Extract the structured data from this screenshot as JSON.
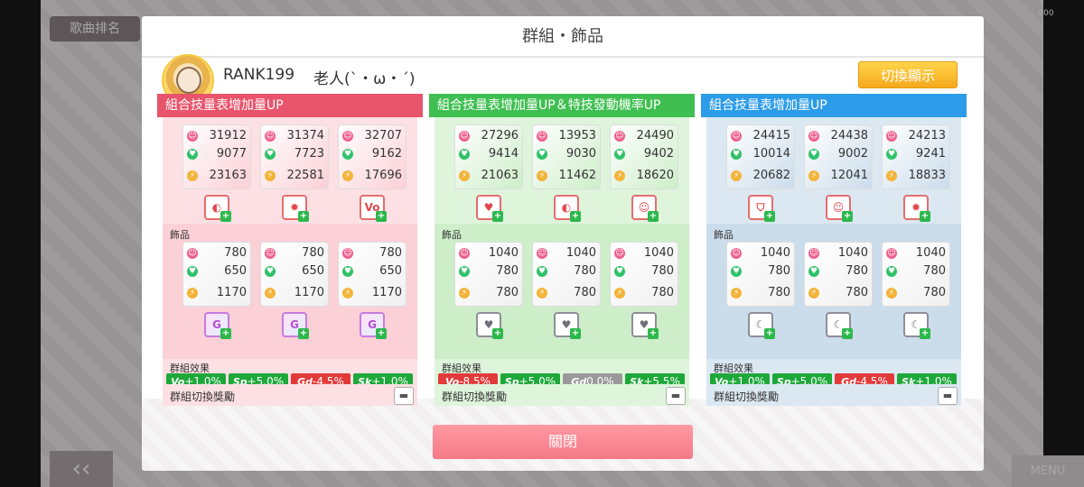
{
  "background": {
    "tab_label": "歌曲排名",
    "left_arrow": "‹‹",
    "menu_label": "MENU",
    "badge_text": "000"
  },
  "dialog": {
    "title": "群組・飾品",
    "rank": "RANK199",
    "nickname": "老人(`・ω・´)",
    "switch_label": "切換顯示",
    "close_label": "關閉",
    "accessories_label": "飾品",
    "effects_label": "群組效果",
    "reward_label": "群組切換獎勵"
  },
  "colors": {
    "pink": "#e8546b",
    "green": "#3fbf51",
    "blue": "#2d9ce8",
    "vo": "#1ea83a",
    "sp": "#1ea83a",
    "gd_neg": "#e23a3a",
    "gd_zero": "#999999"
  },
  "groups": [
    {
      "header": "組合技量表增加量UP",
      "members": [
        {
          "vo": "31912",
          "sp": "9077",
          "gd": "23163",
          "skill": "fan-icon"
        },
        {
          "vo": "31374",
          "sp": "7723",
          "gd": "22581",
          "skill": "burst-icon"
        },
        {
          "vo": "32707",
          "sp": "9162",
          "gd": "17696",
          "skill": "vo-icon"
        }
      ],
      "accessories": [
        {
          "vo": "780",
          "sp": "650",
          "gd": "1170",
          "icon": "g-rainbow-icon"
        },
        {
          "vo": "780",
          "sp": "650",
          "gd": "1170",
          "icon": "g-rainbow-icon"
        },
        {
          "vo": "780",
          "sp": "650",
          "gd": "1170",
          "icon": "g-rainbow-icon"
        }
      ],
      "effects": [
        {
          "stat": "Vo",
          "value": "+1.0%",
          "type": "up"
        },
        {
          "stat": "Sp",
          "value": "+5.0%",
          "type": "up"
        },
        {
          "stat": "Gd",
          "value": "-4.5%",
          "type": "down"
        },
        {
          "stat": "Sk",
          "value": "+1.0%",
          "type": "up"
        }
      ]
    },
    {
      "header": "組合技量表增加量UP＆特技發動機率UP",
      "members": [
        {
          "vo": "27296",
          "sp": "9414",
          "gd": "21063",
          "skill": "heart-icon"
        },
        {
          "vo": "13953",
          "sp": "9030",
          "gd": "11462",
          "skill": "fan-icon"
        },
        {
          "vo": "24490",
          "sp": "9402",
          "gd": "18620",
          "skill": "smile-icon"
        }
      ],
      "accessories": [
        {
          "vo": "1040",
          "sp": "780",
          "gd": "780",
          "icon": "heart-gray-icon"
        },
        {
          "vo": "1040",
          "sp": "780",
          "gd": "780",
          "icon": "heart-gray-icon"
        },
        {
          "vo": "1040",
          "sp": "780",
          "gd": "780",
          "icon": "heart-gray-icon"
        }
      ],
      "effects": [
        {
          "stat": "Vo",
          "value": "-8.5%",
          "type": "down"
        },
        {
          "stat": "Sp",
          "value": "+5.0%",
          "type": "up"
        },
        {
          "stat": "Gd",
          "value": "0.0%",
          "type": "zero"
        },
        {
          "stat": "Sk",
          "value": "+5.5%",
          "type": "up"
        }
      ]
    },
    {
      "header": "組合技量表增加量UP",
      "members": [
        {
          "vo": "24415",
          "sp": "10014",
          "gd": "20682",
          "skill": "shield-icon"
        },
        {
          "vo": "24438",
          "sp": "9002",
          "gd": "12041",
          "skill": "smile-icon"
        },
        {
          "vo": "24213",
          "sp": "9241",
          "gd": "18833",
          "skill": "burst-icon"
        }
      ],
      "accessories": [
        {
          "vo": "1040",
          "sp": "780",
          "gd": "780",
          "icon": "moon-gray-icon"
        },
        {
          "vo": "1040",
          "sp": "780",
          "gd": "780",
          "icon": "moon-gray-icon"
        },
        {
          "vo": "1040",
          "sp": "780",
          "gd": "780",
          "icon": "moon-gray-icon"
        }
      ],
      "effects": [
        {
          "stat": "Vo",
          "value": "+1.0%",
          "type": "up"
        },
        {
          "stat": "Sp",
          "value": "+5.0%",
          "type": "up"
        },
        {
          "stat": "Gd",
          "value": "-4.5%",
          "type": "down"
        },
        {
          "stat": "Sk",
          "value": "+1.0%",
          "type": "up"
        }
      ]
    }
  ]
}
